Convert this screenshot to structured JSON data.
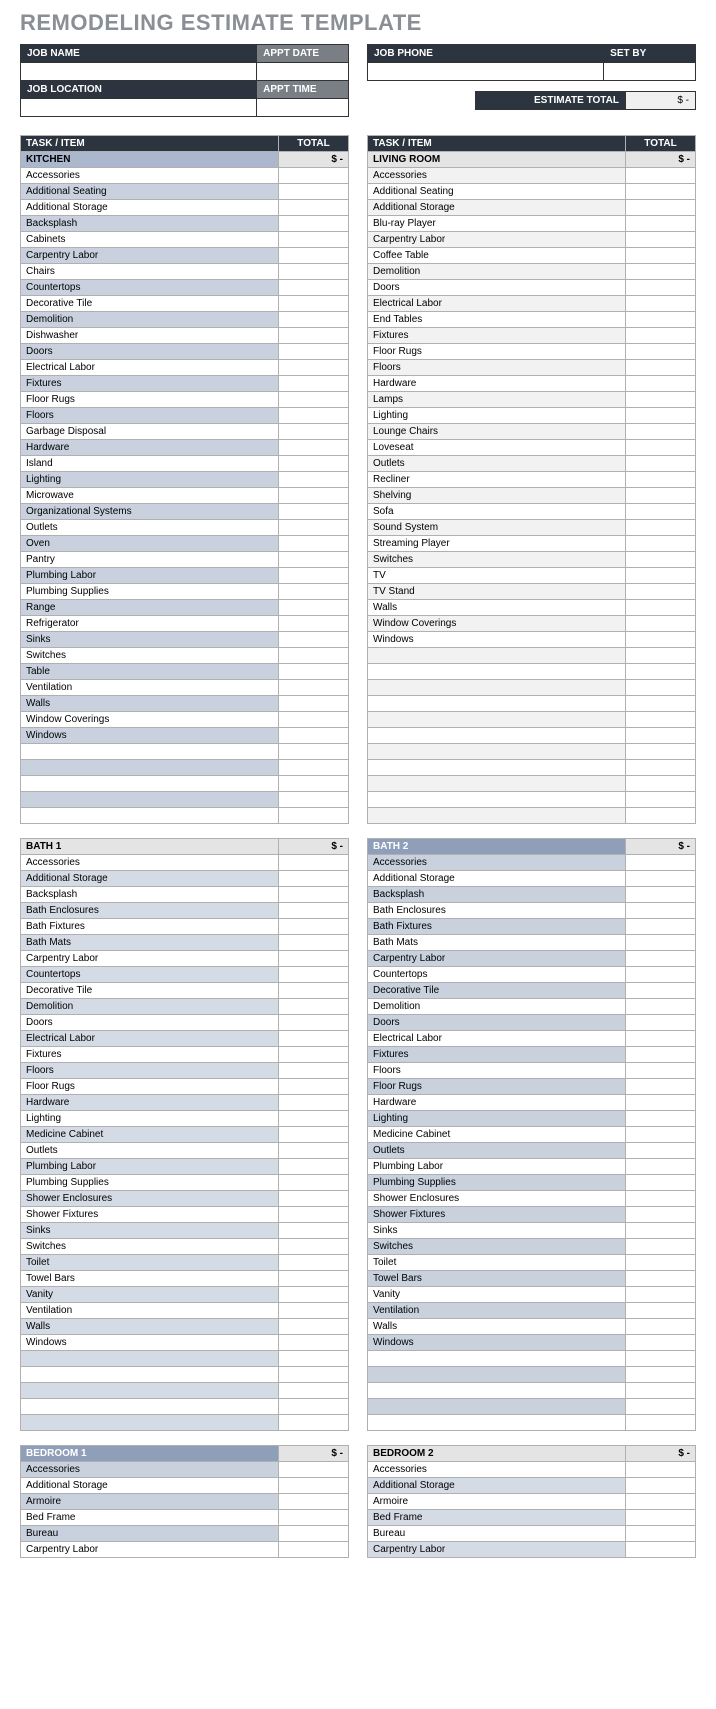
{
  "title": "REMODELING ESTIMATE TEMPLATE",
  "header_left": {
    "job_name_label": "JOB NAME",
    "appt_date_label": "APPT DATE",
    "job_location_label": "JOB LOCATION",
    "appt_time_label": "APPT TIME",
    "job_name": "",
    "appt_date": "",
    "job_location": "",
    "appt_time": ""
  },
  "header_right": {
    "job_phone_label": "JOB PHONE",
    "set_by_label": "SET BY",
    "job_phone": "",
    "set_by": ""
  },
  "estimate_total": {
    "label": "ESTIMATE TOTAL",
    "value": "$            -"
  },
  "col_task": "TASK / ITEM",
  "col_total": "TOTAL",
  "sections": {
    "kitchen": {
      "name": "KITCHEN",
      "total": "$            -",
      "items": [
        "Accessories",
        "Additional Seating",
        "Additional Storage",
        "Backsplash",
        "Cabinets",
        "Carpentry Labor",
        "Chairs",
        "Countertops",
        "Decorative Tile",
        "Demolition",
        "Dishwasher",
        "Doors",
        "Electrical Labor",
        "Fixtures",
        "Floor Rugs",
        "Floors",
        "Garbage Disposal",
        "Hardware",
        "Island",
        "Lighting",
        "Microwave",
        "Organizational Systems",
        "Outlets",
        "Oven",
        "Pantry",
        "Plumbing Labor",
        "Plumbing Supplies",
        "Range",
        "Refrigerator",
        "Sinks",
        "Switches",
        "Table",
        "Ventilation",
        "Walls",
        "Window Coverings",
        "Windows",
        "",
        "",
        "",
        "",
        ""
      ]
    },
    "living": {
      "name": "LIVING ROOM",
      "total": "$            -",
      "items": [
        "Accessories",
        "Additional Seating",
        "Additional Storage",
        "Blu-ray Player",
        "Carpentry Labor",
        "Coffee Table",
        "Demolition",
        "Doors",
        "Electrical Labor",
        "End Tables",
        "Fixtures",
        "Floor Rugs",
        "Floors",
        "Hardware",
        "Lamps",
        "Lighting",
        "Lounge Chairs",
        "Loveseat",
        "Outlets",
        "Recliner",
        "Shelving",
        "Sofa",
        "Sound System",
        "Streaming Player",
        "Switches",
        "TV",
        "TV Stand",
        "Walls",
        "Window Coverings",
        "Windows",
        "",
        "",
        "",
        "",
        "",
        "",
        "",
        "",
        "",
        "",
        ""
      ]
    },
    "bath1": {
      "name": "BATH 1",
      "total": "$            -",
      "items": [
        "Accessories",
        "Additional Storage",
        "Backsplash",
        "Bath Enclosures",
        "Bath Fixtures",
        "Bath Mats",
        "Carpentry Labor",
        "Countertops",
        "Decorative Tile",
        "Demolition",
        "Doors",
        "Electrical Labor",
        "Fixtures",
        "Floors",
        "Floor Rugs",
        "Hardware",
        "Lighting",
        "Medicine Cabinet",
        "Outlets",
        "Plumbing Labor",
        "Plumbing Supplies",
        "Shower Enclosures",
        "Shower Fixtures",
        "Sinks",
        "Switches",
        "Toilet",
        "Towel Bars",
        "Vanity",
        "Ventilation",
        "Walls",
        "Windows",
        "",
        "",
        "",
        "",
        ""
      ]
    },
    "bath2": {
      "name": "BATH 2",
      "total": "$            -",
      "items": [
        "Accessories",
        "Additional Storage",
        "Backsplash",
        "Bath Enclosures",
        "Bath Fixtures",
        "Bath Mats",
        "Carpentry Labor",
        "Countertops",
        "Decorative Tile",
        "Demolition",
        "Doors",
        "Electrical Labor",
        "Fixtures",
        "Floors",
        "Floor Rugs",
        "Hardware",
        "Lighting",
        "Medicine Cabinet",
        "Outlets",
        "Plumbing Labor",
        "Plumbing Supplies",
        "Shower Enclosures",
        "Shower Fixtures",
        "Sinks",
        "Switches",
        "Toilet",
        "Towel Bars",
        "Vanity",
        "Ventilation",
        "Walls",
        "Windows",
        "",
        "",
        "",
        "",
        ""
      ]
    },
    "bed1": {
      "name": "BEDROOM 1",
      "total": "$            -",
      "items": [
        "Accessories",
        "Additional Storage",
        "Armoire",
        "Bed Frame",
        "Bureau",
        "Carpentry Labor"
      ]
    },
    "bed2": {
      "name": "BEDROOM 2",
      "total": "$            -",
      "items": [
        "Accessories",
        "Additional Storage",
        "Armoire",
        "Bed Frame",
        "Bureau",
        "Carpentry Labor"
      ]
    }
  }
}
